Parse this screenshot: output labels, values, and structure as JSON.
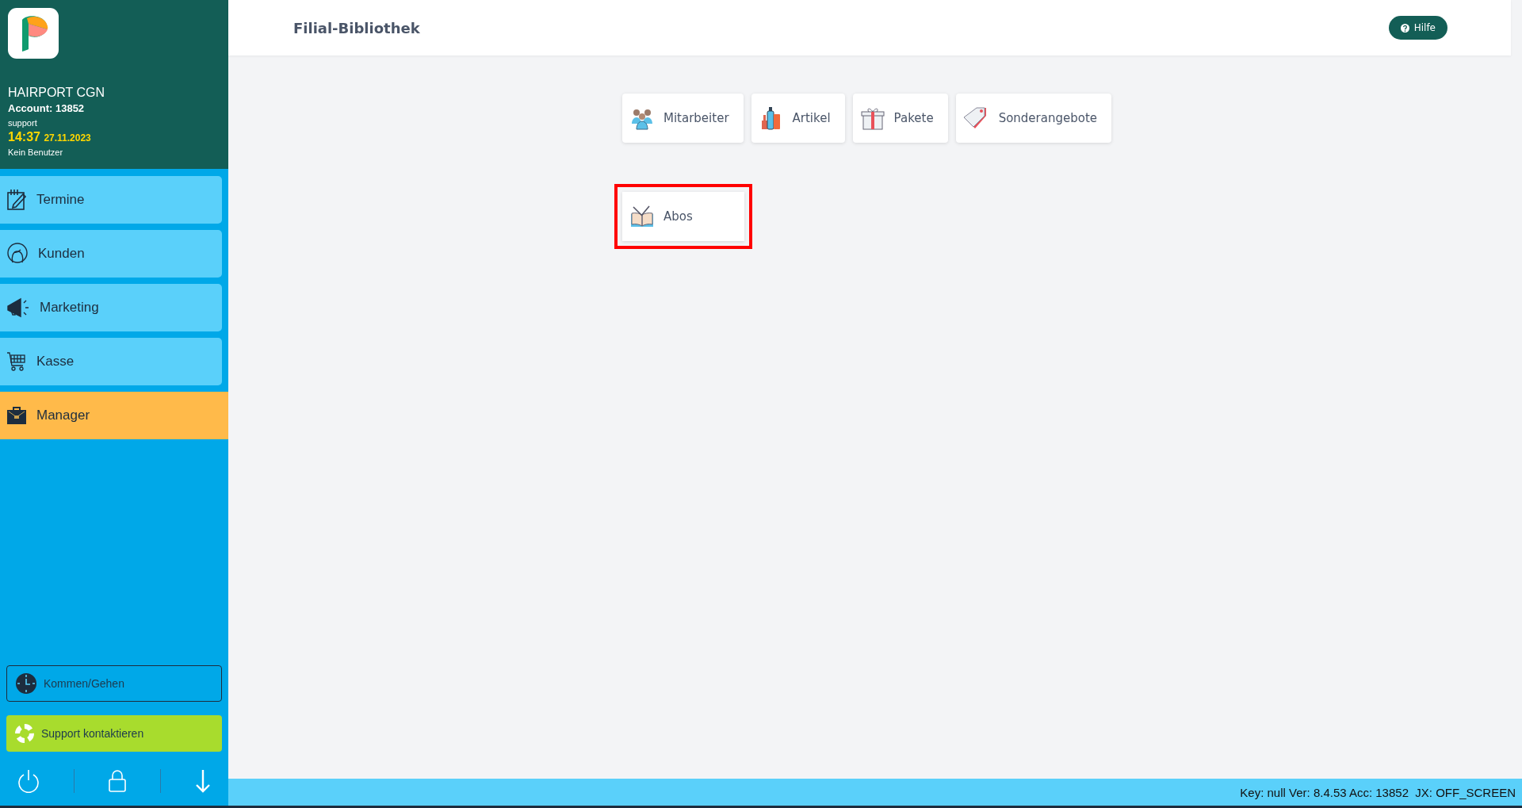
{
  "sidebar": {
    "account": {
      "name": "HAIRPORT CGN",
      "account": "Account: 13852",
      "user": "support",
      "time": "14:37",
      "date": "27.11.2023",
      "status": "Kein Benutzer"
    },
    "nav": [
      {
        "label": "Termine",
        "kind": "calendar",
        "selected": false
      },
      {
        "label": "Kunden",
        "kind": "customer",
        "selected": false
      },
      {
        "label": "Marketing",
        "kind": "megaphone",
        "selected": false
      },
      {
        "label": "Kasse",
        "kind": "cart",
        "selected": false
      },
      {
        "label": "Manager",
        "kind": "briefcase",
        "selected": true
      }
    ],
    "actions": [
      {
        "label": "Kommen/Gehen",
        "kind": "clock"
      },
      {
        "label": "Support kontaktieren",
        "kind": "support"
      }
    ]
  },
  "header": {
    "title": "Filial-Bibliothek",
    "help": "Hilfe"
  },
  "tiles": [
    [
      {
        "label": "Mitarbeiter",
        "kind": "staff",
        "highlighted": false
      },
      {
        "label": "Artikel",
        "kind": "products",
        "highlighted": false
      },
      {
        "label": "Pakete",
        "kind": "gift",
        "highlighted": false
      },
      {
        "label": "Sonderangebote",
        "kind": "tag",
        "highlighted": false
      }
    ],
    [
      {
        "label": "Abos",
        "kind": "book",
        "highlighted": true
      }
    ]
  ],
  "status_bar": "Key: null Ver: 8.4.53 Acc: 13852  JX: OFF_SCREEN"
}
